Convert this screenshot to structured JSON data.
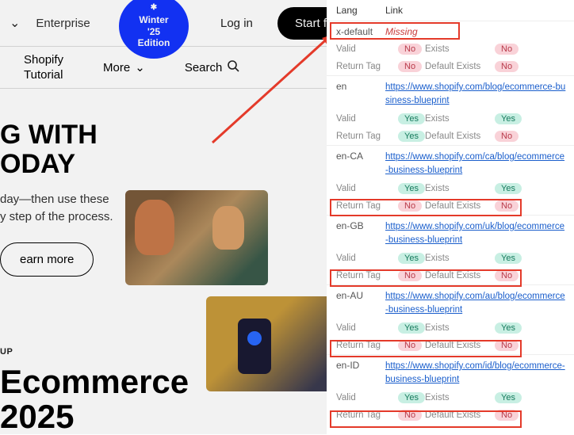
{
  "nav": {
    "enterprise": "Enterprise",
    "badge_line1": "Winter",
    "badge_line2": "'25",
    "badge_line3": "Edition",
    "login": "Log in",
    "start": "Start f"
  },
  "subnav": {
    "tutorial_l1": "Shopify",
    "tutorial_l2": "Tutorial",
    "more": "More",
    "search": "Search"
  },
  "hero": {
    "h1_l1": "G WITH",
    "h1_l2": "ODAY",
    "p_l1": "day—then use these",
    "p_l2": "y step of the process.",
    "learn": "earn more"
  },
  "section2": {
    "sup": "UP",
    "h2_l1": "Ecommerce",
    "h2_l2": "2025"
  },
  "panel": {
    "head_lang": "Lang",
    "head_link": "Link",
    "labels": {
      "valid": "Valid",
      "exists": "Exists",
      "return": "Return Tag",
      "default_exists": "Default Exists"
    },
    "pill": {
      "yes": "Yes",
      "no": "No"
    },
    "blocks": [
      {
        "lang": "x-default",
        "missing": "Missing",
        "r1": {
          "v": "no",
          "e": "no"
        },
        "r2": {
          "rt": "no",
          "de": "no"
        }
      },
      {
        "lang": "en",
        "link": "https://www.shopify.com/blog/ecommerce-business-blueprint",
        "r1": {
          "v": "yes",
          "e": "yes"
        },
        "r2": {
          "rt": "yes",
          "de": "no"
        }
      },
      {
        "lang": "en-CA",
        "link": "https://www.shopify.com/ca/blog/ecommerce-business-blueprint",
        "r1": {
          "v": "yes",
          "e": "yes"
        },
        "r2": {
          "rt": "no",
          "de": "no"
        }
      },
      {
        "lang": "en-GB",
        "link": "https://www.shopify.com/uk/blog/ecommerce-business-blueprint",
        "r1": {
          "v": "yes",
          "e": "yes"
        },
        "r2": {
          "rt": "no",
          "de": "no"
        }
      },
      {
        "lang": "en-AU",
        "link": "https://www.shopify.com/au/blog/ecommerce-business-blueprint",
        "r1": {
          "v": "yes",
          "e": "yes"
        },
        "r2": {
          "rt": "no",
          "de": "no"
        }
      },
      {
        "lang": "en-ID",
        "link": "https://www.shopify.com/id/blog/ecommerce-business-blueprint",
        "r1": {
          "v": "yes",
          "e": "yes"
        },
        "r2": {
          "rt": "no",
          "de": "no"
        }
      }
    ]
  }
}
